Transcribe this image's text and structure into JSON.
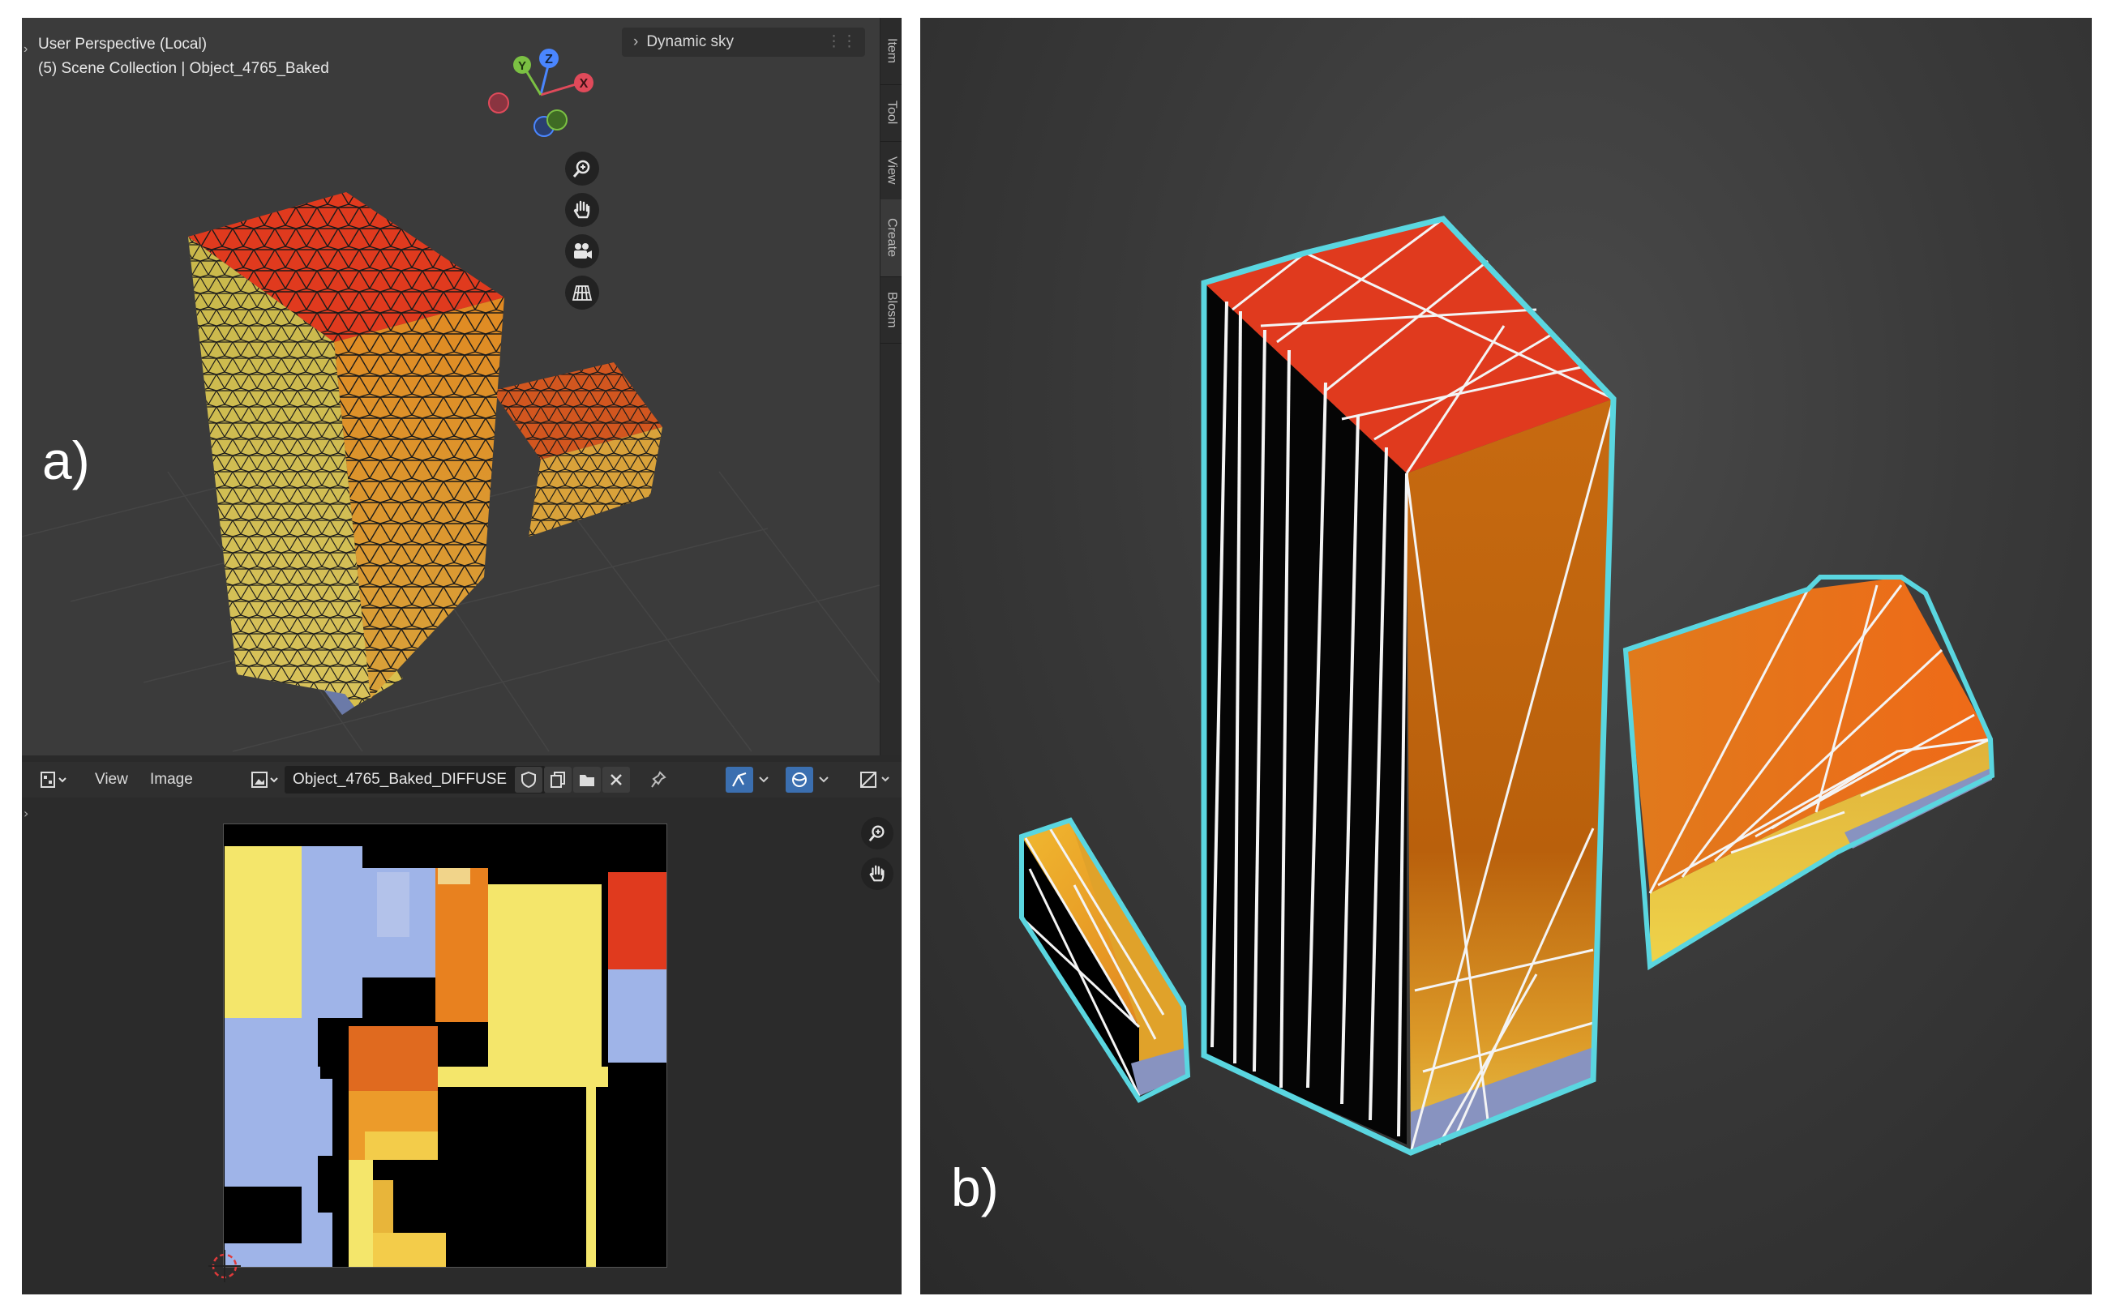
{
  "panel_a": {
    "label": "a)",
    "viewport": {
      "title": "User Perspective (Local)",
      "subtitle": "(5) Scene Collection | Object_4765_Baked",
      "dynamic_sky_label": "Dynamic sky",
      "gizmo_axes": [
        "X",
        "Y",
        "Z"
      ],
      "nav_icons": [
        "zoom-icon",
        "pan-hand-icon",
        "camera-icon",
        "grid-perspective-icon"
      ],
      "side_tabs": [
        "Item",
        "Tool",
        "View",
        "Create",
        "Blosm"
      ]
    },
    "image_editor": {
      "menu_view": "View",
      "menu_image": "Image",
      "image_name": "Object_4765_Baked_DIFFUSE"
    }
  },
  "panel_b": {
    "label": "b)"
  },
  "colors": {
    "roof_red": "#e03a1e",
    "facade_orange": "#d4731c",
    "ochre": "#e0b23a",
    "uv_yellow": "#f3e36a",
    "uv_blue": "#9fb4e8",
    "outline_cyan": "#5ad6e0"
  }
}
